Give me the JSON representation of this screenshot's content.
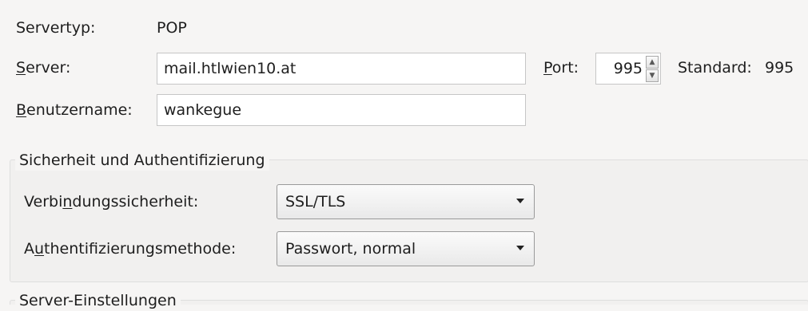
{
  "server_type": {
    "label": "Servertyp:",
    "value": "POP"
  },
  "server": {
    "label_first": "S",
    "label_rest": "erver:",
    "value": "mail.htlwien10.at"
  },
  "port": {
    "label_first": "P",
    "label_rest": "ort:",
    "value": "995",
    "default_label": "Standard:",
    "default_value": "995"
  },
  "username": {
    "label_first": "B",
    "label_rest": "enutzername:",
    "value": "wankegue"
  },
  "security": {
    "legend": "Sicherheit und Authentifizierung",
    "connection": {
      "label_pre": "Verbi",
      "label_acc": "n",
      "label_post": "dungssicherheit:",
      "value": "SSL/TLS"
    },
    "auth": {
      "label_pre": "A",
      "label_acc": "u",
      "label_post": "thentifizierungsmethode:",
      "value": "Passwort, normal"
    }
  },
  "server_settings": {
    "legend": "Server-Einstellungen"
  }
}
